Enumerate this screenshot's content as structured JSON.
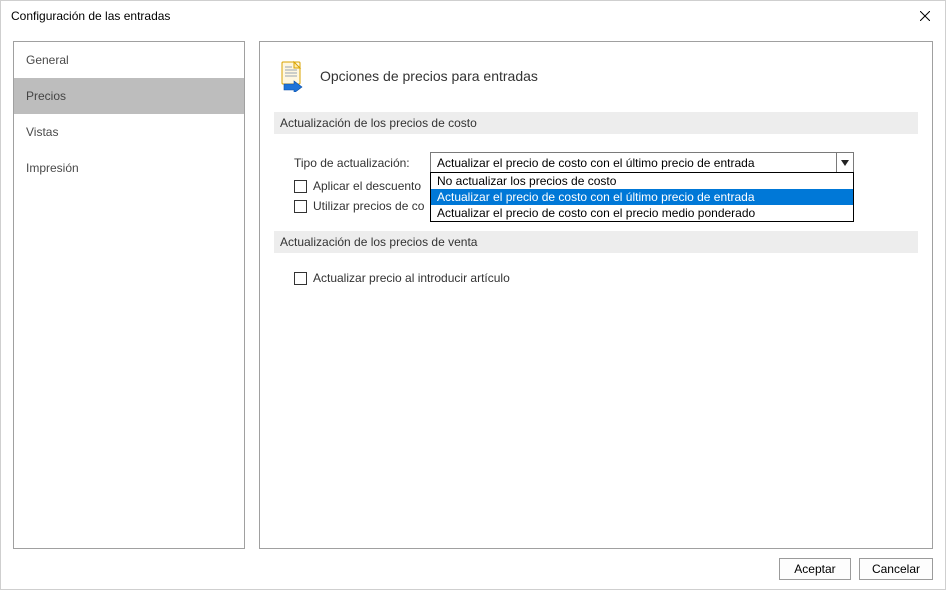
{
  "window": {
    "title": "Configuración de las entradas"
  },
  "sidebar": {
    "items": [
      {
        "label": "General",
        "selected": false
      },
      {
        "label": "Precios",
        "selected": true
      },
      {
        "label": "Vistas",
        "selected": false
      },
      {
        "label": "Impresión",
        "selected": false
      }
    ]
  },
  "page": {
    "title": "Opciones de precios para entradas"
  },
  "cost_group": {
    "header": "Actualización de los precios de costo",
    "update_type_label": "Tipo de actualización:",
    "combo": {
      "value": "Actualizar el precio de costo con el último precio de entrada",
      "options": [
        "No actualizar los precios de costo",
        "Actualizar el precio de costo con el último precio de entrada",
        "Actualizar el precio de costo con el precio medio ponderado"
      ],
      "selected_index": 1
    },
    "apply_discount_label": "Aplicar el descuento",
    "use_cost_prices_label": "Utilizar precios de co"
  },
  "sales_group": {
    "header": "Actualización de los precios de venta",
    "update_on_insert_label": "Actualizar precio al introducir artículo"
  },
  "footer": {
    "accept": "Aceptar",
    "cancel": "Cancelar"
  }
}
